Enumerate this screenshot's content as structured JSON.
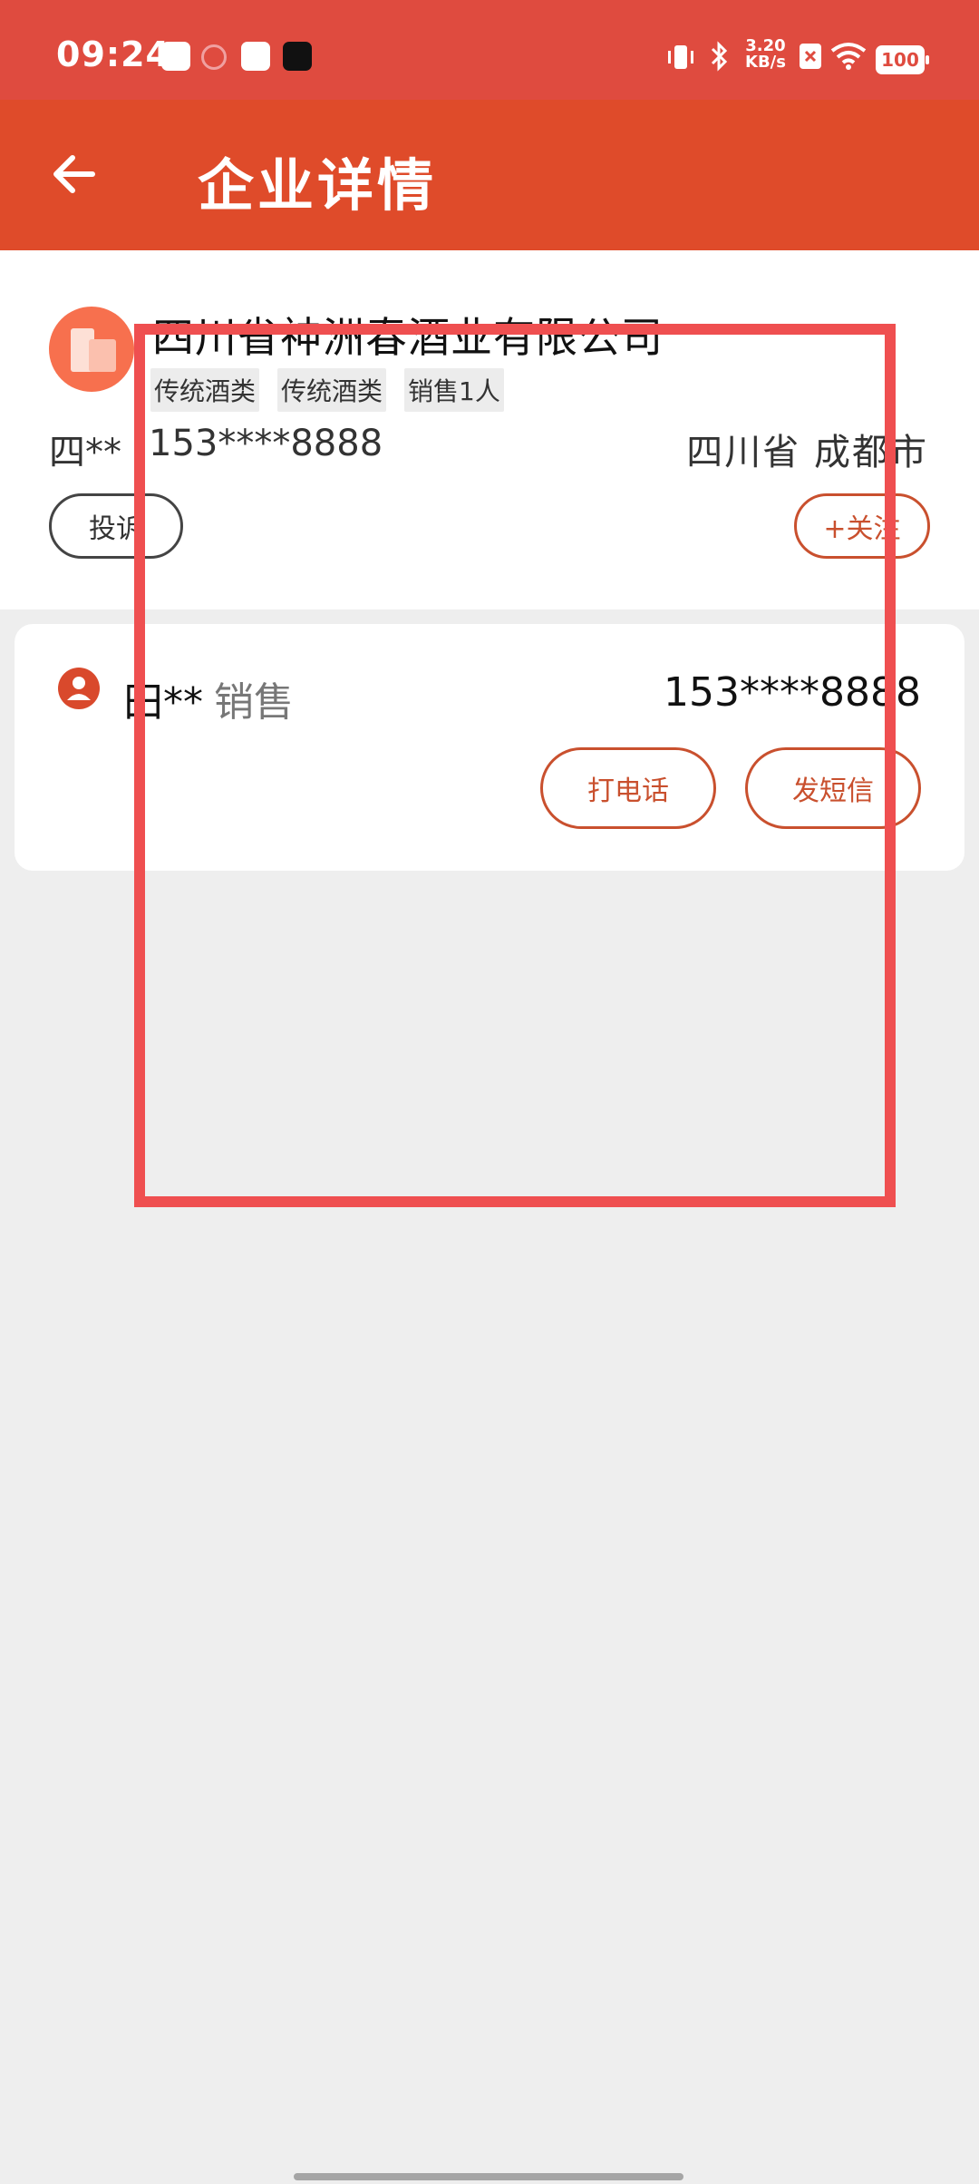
{
  "status_bar": {
    "time": "09:24",
    "network_speed_value": "3.20",
    "network_speed_unit": "KB/s",
    "battery": "100",
    "icons": [
      "shopping-bag-icon",
      "vivo-icon",
      "tiktok-icon",
      "vibrate-icon",
      "bluetooth-icon",
      "no-sim-icon",
      "wifi-icon"
    ]
  },
  "app_bar": {
    "title": "企业详情",
    "back_icon": "arrow-left-icon"
  },
  "company": {
    "name": "四川省神洲春酒业有限公司",
    "tags": [
      "传统酒类",
      "传统酒类",
      "销售1人"
    ],
    "owner": "四**",
    "phone": "153****8888",
    "province": "四川省",
    "city": "成都市",
    "complain_label": "投诉",
    "follow_label": "+关注"
  },
  "contact": {
    "name": "田**",
    "role": "销售",
    "phone": "153****8888",
    "call_label": "打电话",
    "sms_label": "发短信"
  },
  "colors": {
    "status_bar": "#df4b3f",
    "app_bar": "#df4b2a",
    "accent": "#c9502e",
    "highlight": "#ef4f50",
    "background": "#eeeeee"
  }
}
